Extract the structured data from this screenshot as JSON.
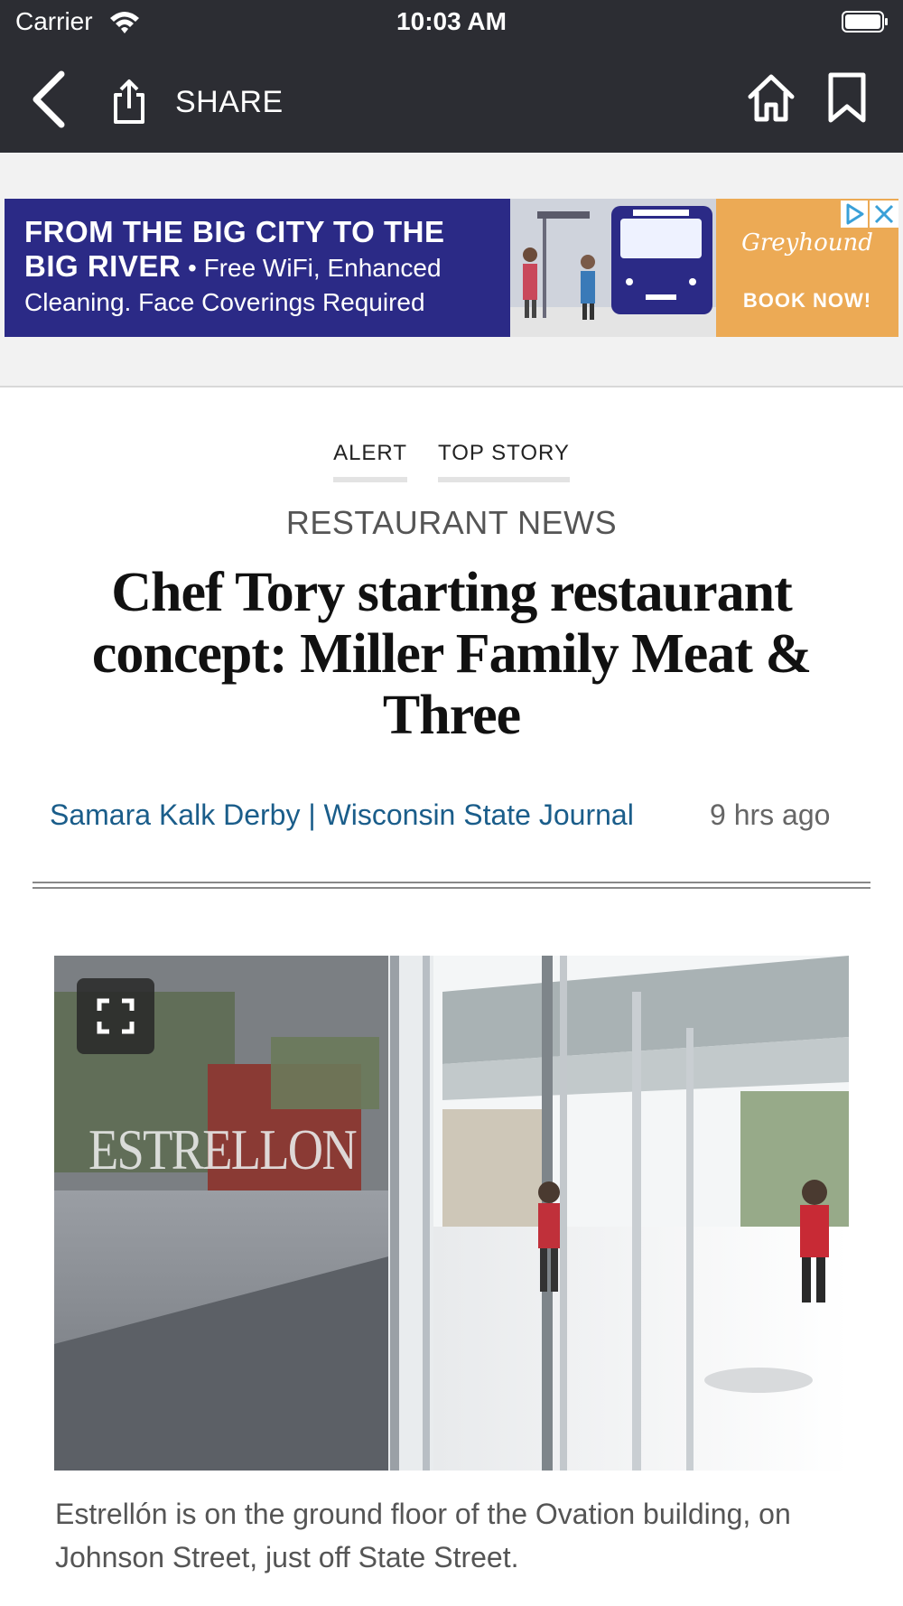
{
  "status_bar": {
    "carrier": "Carrier",
    "time": "10:03 AM"
  },
  "nav": {
    "share_label": "SHARE"
  },
  "ad": {
    "line1": "FROM THE BIG CITY TO THE",
    "line2_bold": "BIG RIVER",
    "line2_rest": " • Free WiFi, Enhanced",
    "line3": "Cleaning. Face Coverings Required",
    "brand": "Greyhound",
    "cta": "BOOK NOW!"
  },
  "article": {
    "tags": [
      "ALERT",
      "TOP STORY"
    ],
    "section": "RESTAURANT NEWS",
    "headline": "Chef Tory starting restaurant concept: Miller Family Meat & Three",
    "byline": "Samara Kalk Derby | Wisconsin State Journal",
    "time_ago": "9 hrs ago",
    "photo_sign_text": "ESTRELLON",
    "caption": "Estrellón is on the ground floor of the Ovation building, on Johnson Street, just off State Street."
  },
  "colors": {
    "header_bg": "#2c2d33",
    "ad_bg": "#2b2a86",
    "ad_accent": "#ecaa55",
    "byline_link": "#1a5d8a"
  }
}
